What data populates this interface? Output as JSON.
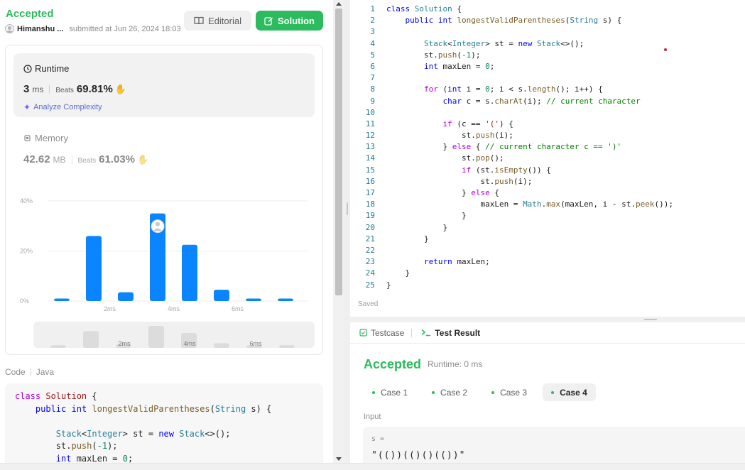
{
  "header": {
    "status": "Accepted",
    "author": "Himanshu ...",
    "submitted": "submitted at Jun 26, 2024 18:03",
    "editorial_label": "Editorial",
    "solution_label": "Solution"
  },
  "runtime": {
    "title": "Runtime",
    "value": "3",
    "unit": "ms",
    "beats_label": "Beats",
    "beats": "69.81%",
    "analyze_label": "Analyze Complexity"
  },
  "memory": {
    "title": "Memory",
    "value": "42.62",
    "unit": "MB",
    "beats_label": "Beats",
    "beats": "61.03%"
  },
  "chart_data": {
    "type": "bar",
    "y_ticks": [
      "40%",
      "20%",
      "0%"
    ],
    "ylim": [
      0,
      40
    ],
    "x_ticks": [
      "2ms",
      "4ms",
      "6ms"
    ],
    "values": [
      1,
      26,
      3.5,
      35,
      22.5,
      4.5,
      1,
      1
    ],
    "highlight_index": 3,
    "bar_color": "#0a84ff"
  },
  "minimap": {
    "x_ticks": [
      "2ms",
      "4ms",
      "6ms"
    ]
  },
  "code_section": {
    "label": "Code",
    "lang": "Java",
    "lines": [
      "class Solution {",
      "    public int longestValidParentheses(String s) {",
      "",
      "        Stack<Integer> st = new Stack<>();",
      "        st.push(-1);",
      "        int maxLen = 0;"
    ]
  },
  "editor": {
    "saved_label": "Saved",
    "lines": [
      "class Solution {",
      "    public int longestValidParentheses(String s) {",
      "",
      "        Stack<Integer> st = new Stack<>();",
      "        st.push(-1);",
      "        int maxLen = 0;",
      "",
      "        for (int i = 0; i < s.length(); i++) {",
      "            char c = s.charAt(i); // current character",
      "",
      "            if (c == '(') {",
      "                st.push(i);",
      "            } else { // current character c == ')'",
      "                st.pop();",
      "                if (st.isEmpty()) {",
      "                    st.push(i);",
      "                } else {",
      "                    maxLen = Math.max(maxLen, i - st.peek());",
      "                }",
      "            }",
      "        }",
      "",
      "        return maxLen;",
      "    }",
      "}"
    ]
  },
  "result": {
    "tab_testcase": "Testcase",
    "tab_result": "Test Result",
    "status": "Accepted",
    "runtime": "Runtime: 0 ms",
    "cases": [
      "Case 1",
      "Case 2",
      "Case 3",
      "Case 4"
    ],
    "active_case": 3,
    "input_label": "Input",
    "input_var": "s =",
    "input_value": "\"(())(()()(())\""
  }
}
